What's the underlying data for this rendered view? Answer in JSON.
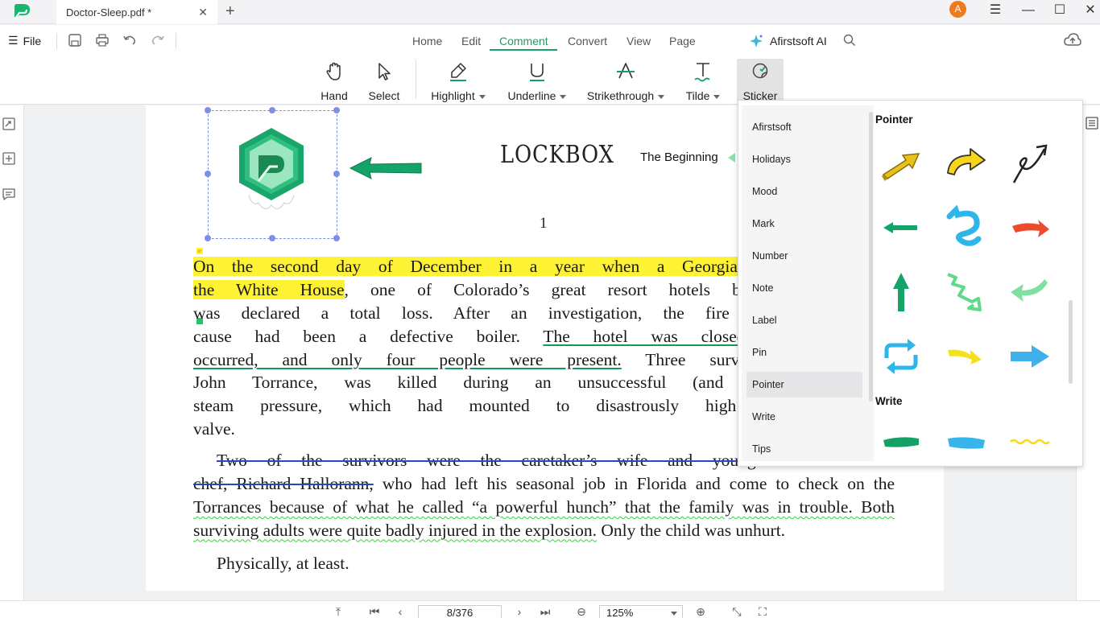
{
  "titlebar": {
    "tab_title": "Doctor-Sleep.pdf *",
    "avatar_letter": "A"
  },
  "menubar": {
    "file_label": "File",
    "tabs": [
      "Home",
      "Edit",
      "Comment",
      "Convert",
      "View",
      "Page"
    ],
    "active_tab": "Comment",
    "ai_label": "Afirstsoft AI"
  },
  "toolbar": {
    "tools": [
      {
        "label": "Hand",
        "icon": "hand-icon"
      },
      {
        "label": "Select",
        "icon": "cursor-icon"
      },
      {
        "label": "Highlight",
        "icon": "highlighter-icon",
        "dropdown": true
      },
      {
        "label": "Underline",
        "icon": "underline-icon",
        "dropdown": true
      },
      {
        "label": "Strikethrough",
        "icon": "strikethrough-icon",
        "dropdown": true
      },
      {
        "label": "Tilde",
        "icon": "tilde-icon",
        "dropdown": true
      },
      {
        "label": "Sticker",
        "icon": "sticker-icon",
        "active": true
      }
    ]
  },
  "document": {
    "title": "LOCKBOX",
    "chapter": "The Beginning",
    "page_number": "1",
    "paragraph1": [
      {
        "segs": [
          {
            "t": "On the second day of December in a year when a Georgia peanut farmer w",
            "s": "hl"
          }
        ]
      },
      {
        "segs": [
          {
            "t": "the White House",
            "s": "hl"
          },
          {
            "t": ", one of Colorado’s great resort hotels burned to the gr",
            "s": ""
          }
        ]
      },
      {
        "segs": [
          {
            "t": "was declared a total loss. After an investigation, the fire marshal of Jicar",
            "s": ""
          }
        ]
      },
      {
        "segs": [
          {
            "t": "cause had been a defective boiler. ",
            "s": ""
          },
          {
            "t": "The hotel was closed for the winte",
            "s": "ul"
          }
        ]
      },
      {
        "segs": [
          {
            "t": "occurred, and only four people were present.",
            "s": "ul"
          },
          {
            "t": " Three survived. The hotel’s",
            "s": ""
          }
        ]
      },
      {
        "segs": [
          {
            "t": "John Torrance, was killed during an unsuccessful (and heroic) effort t",
            "s": ""
          }
        ]
      },
      {
        "segs": [
          {
            "t": "steam pressure, which had mounted to disastrously high levels due to",
            "s": ""
          }
        ]
      },
      {
        "segs": [
          {
            "t": "valve.",
            "s": ""
          }
        ]
      }
    ],
    "paragraph2": [
      {
        "segs": [
          {
            "t": "Two of the survivors were the caretaker’s wife and young son. The thir",
            "s": "st"
          }
        ]
      },
      {
        "segs": [
          {
            "t": "chef, Richard Hallorann,",
            "s": "st"
          },
          {
            "t": " who had left his seasonal job in Florida and come to check on the",
            "s": ""
          }
        ]
      },
      {
        "segs": [
          {
            "t": "Torrances because of what he called “a powerful hunch” that the family was in trouble. Both",
            "s": "sq"
          }
        ]
      },
      {
        "segs": [
          {
            "t": "surviving adults were quite badly injured in the explosion.",
            "s": "sq"
          },
          {
            "t": " Only the child was unhurt.",
            "s": ""
          }
        ]
      }
    ],
    "paragraph3": "Physically, at least."
  },
  "sticker_panel": {
    "categories": [
      "Afirstsoft",
      "Holidays",
      "Mood",
      "Mark",
      "Number",
      "Note",
      "Label",
      "Pin",
      "Pointer",
      "Write",
      "Tips"
    ],
    "active_category": "Pointer",
    "sections": [
      {
        "title": "Pointer",
        "items": [
          "gold-3d-arrow",
          "yellow-curved-arrow",
          "black-loop-arrow",
          "green-left-arrow",
          "blue-squiggle-arrow",
          "red-brush-arrow",
          "green-up-arrow",
          "green-zigzag-arrow",
          "mint-curved-arrow",
          "blue-refresh-arrows",
          "yellow-paint-arrow",
          "blue-bold-arrow"
        ]
      },
      {
        "title": "Write",
        "items": [
          "green-brush-stroke",
          "blue-brush-stroke",
          "yellow-wavy-line"
        ]
      }
    ]
  },
  "statusbar": {
    "page_indicator": "8/376",
    "zoom": "125%"
  },
  "colors": {
    "accent": "#16a066",
    "highlight": "#fdf234",
    "strike": "#2b45c9",
    "squiggle": "#3ccc3c",
    "selection": "#7f8fe6"
  }
}
